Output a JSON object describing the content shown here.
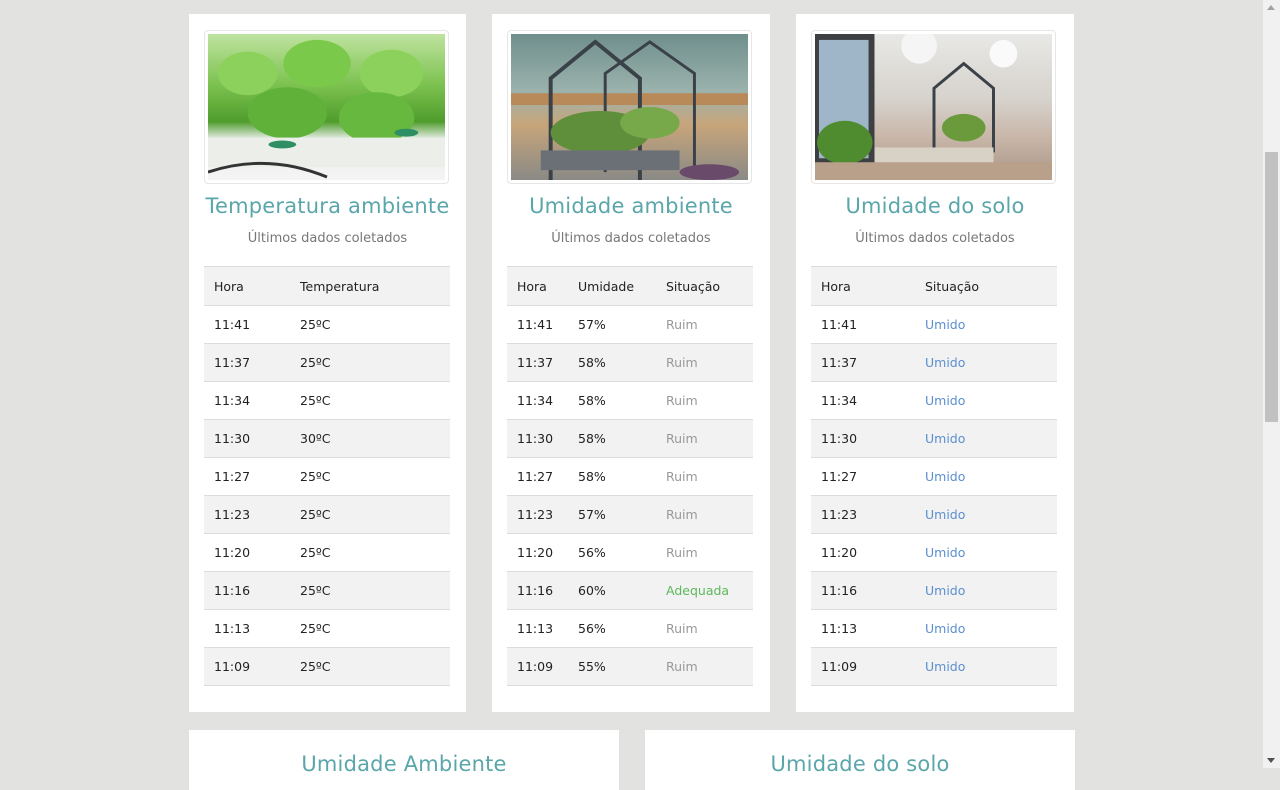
{
  "cards": {
    "temp": {
      "title": "Temperatura ambiente",
      "subtitle": "Últimos dados coletados",
      "columns": [
        "Hora",
        "Temperatura"
      ],
      "rows": [
        [
          "11:41",
          "25ºC"
        ],
        [
          "11:37",
          "25ºC"
        ],
        [
          "11:34",
          "25ºC"
        ],
        [
          "11:30",
          "30ºC"
        ],
        [
          "11:27",
          "25ºC"
        ],
        [
          "11:23",
          "25ºC"
        ],
        [
          "11:20",
          "25ºC"
        ],
        [
          "11:16",
          "25ºC"
        ],
        [
          "11:13",
          "25ºC"
        ],
        [
          "11:09",
          "25ºC"
        ]
      ]
    },
    "umid": {
      "title": "Umidade ambiente",
      "subtitle": "Últimos dados coletados",
      "columns": [
        "Hora",
        "Umidade",
        "Situação"
      ],
      "rows": [
        [
          "11:41",
          "57%",
          "Ruim"
        ],
        [
          "11:37",
          "58%",
          "Ruim"
        ],
        [
          "11:34",
          "58%",
          "Ruim"
        ],
        [
          "11:30",
          "58%",
          "Ruim"
        ],
        [
          "11:27",
          "58%",
          "Ruim"
        ],
        [
          "11:23",
          "57%",
          "Ruim"
        ],
        [
          "11:20",
          "56%",
          "Ruim"
        ],
        [
          "11:16",
          "60%",
          "Adequada"
        ],
        [
          "11:13",
          "56%",
          "Ruim"
        ],
        [
          "11:09",
          "55%",
          "Ruim"
        ]
      ]
    },
    "solo": {
      "title": "Umidade do solo",
      "subtitle": "Últimos dados coletados",
      "columns": [
        "Hora",
        "Situação"
      ],
      "rows": [
        [
          "11:41",
          "Umido"
        ],
        [
          "11:37",
          "Umido"
        ],
        [
          "11:34",
          "Umido"
        ],
        [
          "11:30",
          "Umido"
        ],
        [
          "11:27",
          "Umido"
        ],
        [
          "11:23",
          "Umido"
        ],
        [
          "11:20",
          "Umido"
        ],
        [
          "11:16",
          "Umido"
        ],
        [
          "11:13",
          "Umido"
        ],
        [
          "11:09",
          "Umido"
        ]
      ]
    }
  },
  "bottom_cards": {
    "chart1_title": "Umidade Ambiente",
    "chart2_title": "Umidade do solo"
  },
  "colors": {
    "title": "#5aa6aa",
    "ruim": "#999999",
    "adequada": "#5cb85c",
    "umido": "#5b8fd0"
  },
  "images": [
    "lettuce-hydroponic-photo",
    "indoor-garden-cabinet-photo",
    "kitchen-indoor-garden-photo"
  ]
}
